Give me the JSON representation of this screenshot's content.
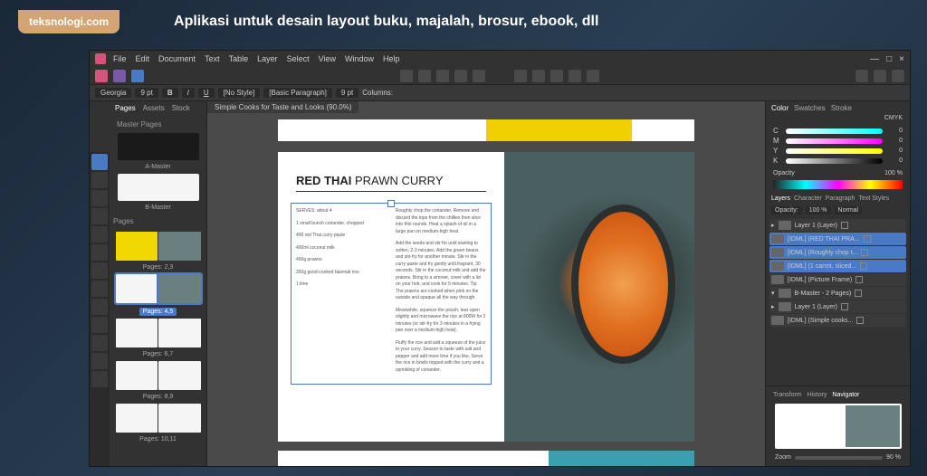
{
  "banner": {
    "brand": "teksnologi.com",
    "tagline": "Aplikasi untuk desain layout buku, majalah, brosur, ebook, dll"
  },
  "menus": [
    "File",
    "Edit",
    "Document",
    "Text",
    "Table",
    "Layer",
    "Select",
    "View",
    "Window",
    "Help"
  ],
  "titlebar": {
    "min": "—",
    "max": "□",
    "close": "×"
  },
  "contextbar": {
    "font": "Georgia",
    "size": "9 pt",
    "style_label": "[No Style]",
    "para_label": "[Basic Paragraph]",
    "leading": "9 pt",
    "columns_label": "Columns:"
  },
  "doc_tab": "Simple Cooks for Taste and Looks (90.0%)",
  "left_panel": {
    "tabs": [
      "Pages",
      "Assets",
      "Stock"
    ],
    "master_header": "Master Pages",
    "masters": [
      "A-Master",
      "B-Master"
    ],
    "pages_header": "Pages",
    "pages": [
      "Pages: 2,3",
      "Pages: 4,5",
      "Pages: 6,7",
      "Pages: 8,9",
      "Pages: 10,11"
    ]
  },
  "spread": {
    "title_bold": "RED THAI",
    "title_rest": " PRAWN CURRY",
    "col1": [
      "SERVES: about 4",
      "1 small bunch coriander, chopped",
      "400 red Thai curry paste",
      "400ml coconut milk",
      "400g prawns",
      "250g good-cooked basmati rice",
      "1 lime"
    ],
    "col2": [
      "Roughly chop the coriander. Remove and discard the tops from the chillies then slice into thin rounds. Heat a splash of oil in a large pan on medium-high heat.",
      "Add the seeds and stir for until starting to soften, 2-3 minutes. Add the green beans and stir-fry for another minute. Stir in the curry paste and fry gently until fragrant, 30 seconds. Stir in the coconut milk and add the prawns. Bring to a simmer, cover with a lid on your hob, and cook for 5 minutes. Tip: The prawns are cooked when pink on the outside and opaque all the way through.",
      "Meanwhile, squeeze the pouch, tear open slightly and microwave the rice at 800W for 2 minutes (or stir-fry for 3 minutes in a frying pan over a medium-high heat).",
      "Fluffy the rice and add a squeeze of the juice to your curry. Season to taste with salt and pepper and add more lime if you like. Serve the rice in bowls topped with the curry and a sprinkling of coriander."
    ]
  },
  "right": {
    "color_tabs": [
      "Color",
      "Swatches",
      "Stroke"
    ],
    "mode": "CMYK",
    "sliders": [
      {
        "lbl": "C",
        "val": "0"
      },
      {
        "lbl": "M",
        "val": "0"
      },
      {
        "lbl": "Y",
        "val": "0"
      },
      {
        "lbl": "K",
        "val": "0"
      }
    ],
    "opacity_label": "Opacity",
    "opacity_val": "100 %",
    "layer_tabs": [
      "Layers",
      "Character",
      "Paragraph",
      "Text Styles"
    ],
    "layer_opacity_label": "Opacity:",
    "layer_opacity_val": "100 %",
    "blend": "Normal",
    "layers": [
      {
        "name": "Layer 1 (Layer)",
        "sel": false,
        "group": true
      },
      {
        "name": "[IDML] (RED THAI PRA...",
        "sel": true
      },
      {
        "name": "[IDML] (Roughly chop t...",
        "sel": true
      },
      {
        "name": "[IDML] (1 carrot, sliced...",
        "sel": true
      },
      {
        "name": "[IDML] (Picture Frame)",
        "sel": false
      },
      {
        "name": "B-Master - 2 Pages)",
        "sel": false,
        "group": true
      },
      {
        "name": "Layer 1 (Layer)",
        "sel": false,
        "group": true
      },
      {
        "name": "[IDML] (Simple cooks...",
        "sel": false
      }
    ],
    "nav_tabs": [
      "Transform",
      "History",
      "Navigator"
    ],
    "zoom_label": "Zoom",
    "zoom_val": "90 %"
  }
}
